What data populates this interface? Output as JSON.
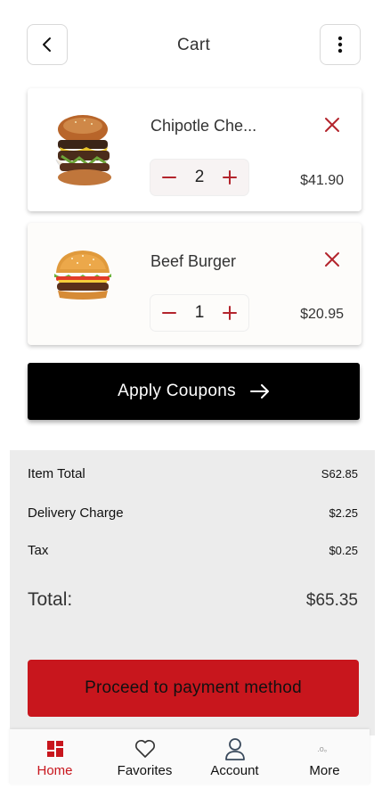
{
  "header": {
    "title": "Cart",
    "back_icon": "chevron-left-icon",
    "menu_icon": "kebab-menu-icon"
  },
  "cart_items": [
    {
      "name": "Chipotle Che...",
      "quantity": "2",
      "price": "$41.90",
      "image": "burger-stack-image"
    },
    {
      "name": "Beef Burger",
      "quantity": "1",
      "price": "$20.95",
      "image": "beef-burger-image"
    }
  ],
  "coupon": {
    "label": "Apply Coupons",
    "icon": "arrow-right-icon"
  },
  "summary": {
    "item_total_label": "Item Total",
    "item_total_value": "S62.85",
    "delivery_label": "Delivery Charge",
    "delivery_value": "$2.25",
    "tax_label": "Tax",
    "tax_value": "$0.25",
    "total_label": "Total:",
    "total_value": "$65.35"
  },
  "payment_button": {
    "label": "Proceed to payment method"
  },
  "bottom_nav": [
    {
      "label": "Home",
      "icon": "home-grid-icon",
      "active": true
    },
    {
      "label": "Favorites",
      "icon": "heart-icon",
      "active": false
    },
    {
      "label": "Account",
      "icon": "user-icon",
      "active": false
    },
    {
      "label": "More",
      "icon": "more-dots-icon",
      "active": false,
      "glyph": ".o。"
    }
  ],
  "colors": {
    "accent": "#c8161d",
    "coupon_button": "#000000",
    "summary_background": "#ececec"
  }
}
